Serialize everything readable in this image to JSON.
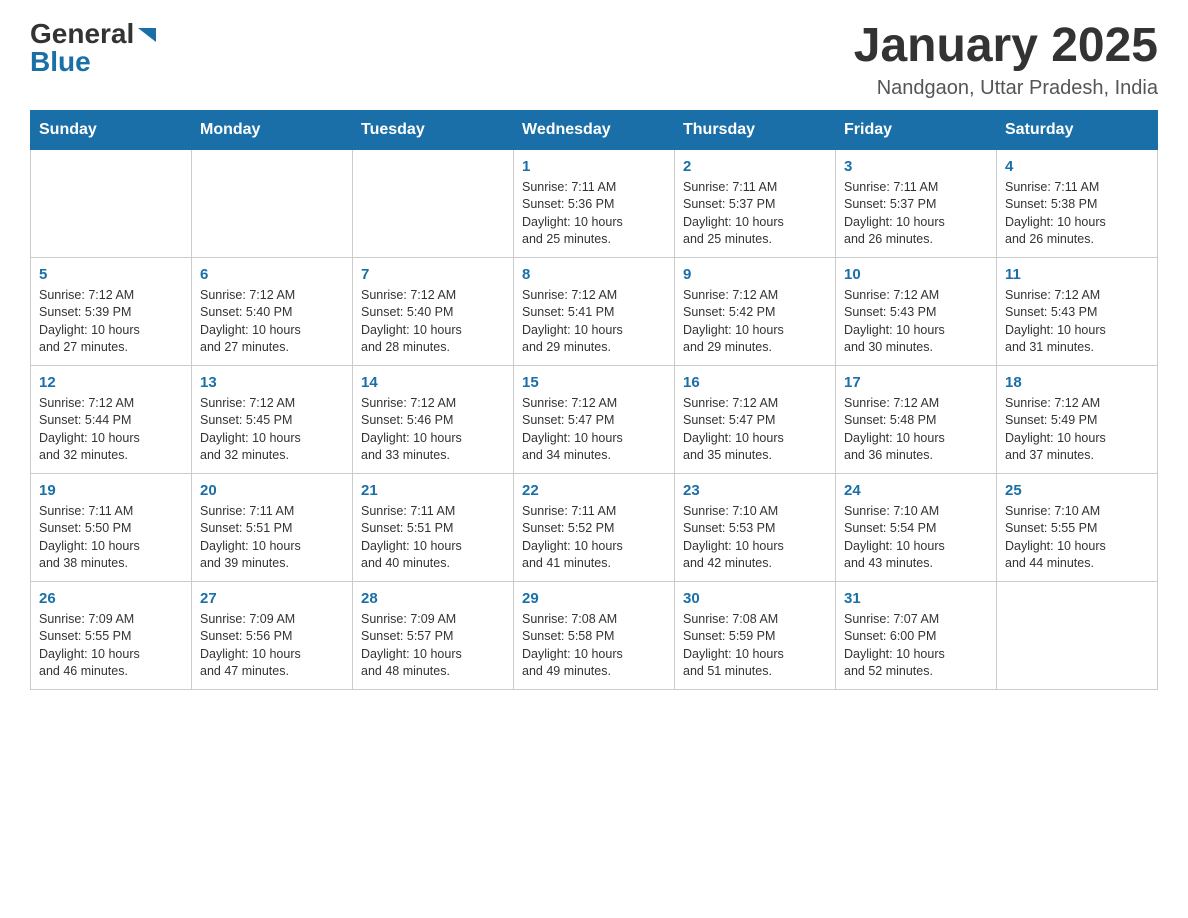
{
  "header": {
    "logo_general": "General",
    "logo_blue": "Blue",
    "month_title": "January 2025",
    "location": "Nandgaon, Uttar Pradesh, India"
  },
  "weekdays": [
    "Sunday",
    "Monday",
    "Tuesday",
    "Wednesday",
    "Thursday",
    "Friday",
    "Saturday"
  ],
  "weeks": [
    [
      {
        "day": "",
        "info": ""
      },
      {
        "day": "",
        "info": ""
      },
      {
        "day": "",
        "info": ""
      },
      {
        "day": "1",
        "info": "Sunrise: 7:11 AM\nSunset: 5:36 PM\nDaylight: 10 hours\nand 25 minutes."
      },
      {
        "day": "2",
        "info": "Sunrise: 7:11 AM\nSunset: 5:37 PM\nDaylight: 10 hours\nand 25 minutes."
      },
      {
        "day": "3",
        "info": "Sunrise: 7:11 AM\nSunset: 5:37 PM\nDaylight: 10 hours\nand 26 minutes."
      },
      {
        "day": "4",
        "info": "Sunrise: 7:11 AM\nSunset: 5:38 PM\nDaylight: 10 hours\nand 26 minutes."
      }
    ],
    [
      {
        "day": "5",
        "info": "Sunrise: 7:12 AM\nSunset: 5:39 PM\nDaylight: 10 hours\nand 27 minutes."
      },
      {
        "day": "6",
        "info": "Sunrise: 7:12 AM\nSunset: 5:40 PM\nDaylight: 10 hours\nand 27 minutes."
      },
      {
        "day": "7",
        "info": "Sunrise: 7:12 AM\nSunset: 5:40 PM\nDaylight: 10 hours\nand 28 minutes."
      },
      {
        "day": "8",
        "info": "Sunrise: 7:12 AM\nSunset: 5:41 PM\nDaylight: 10 hours\nand 29 minutes."
      },
      {
        "day": "9",
        "info": "Sunrise: 7:12 AM\nSunset: 5:42 PM\nDaylight: 10 hours\nand 29 minutes."
      },
      {
        "day": "10",
        "info": "Sunrise: 7:12 AM\nSunset: 5:43 PM\nDaylight: 10 hours\nand 30 minutes."
      },
      {
        "day": "11",
        "info": "Sunrise: 7:12 AM\nSunset: 5:43 PM\nDaylight: 10 hours\nand 31 minutes."
      }
    ],
    [
      {
        "day": "12",
        "info": "Sunrise: 7:12 AM\nSunset: 5:44 PM\nDaylight: 10 hours\nand 32 minutes."
      },
      {
        "day": "13",
        "info": "Sunrise: 7:12 AM\nSunset: 5:45 PM\nDaylight: 10 hours\nand 32 minutes."
      },
      {
        "day": "14",
        "info": "Sunrise: 7:12 AM\nSunset: 5:46 PM\nDaylight: 10 hours\nand 33 minutes."
      },
      {
        "day": "15",
        "info": "Sunrise: 7:12 AM\nSunset: 5:47 PM\nDaylight: 10 hours\nand 34 minutes."
      },
      {
        "day": "16",
        "info": "Sunrise: 7:12 AM\nSunset: 5:47 PM\nDaylight: 10 hours\nand 35 minutes."
      },
      {
        "day": "17",
        "info": "Sunrise: 7:12 AM\nSunset: 5:48 PM\nDaylight: 10 hours\nand 36 minutes."
      },
      {
        "day": "18",
        "info": "Sunrise: 7:12 AM\nSunset: 5:49 PM\nDaylight: 10 hours\nand 37 minutes."
      }
    ],
    [
      {
        "day": "19",
        "info": "Sunrise: 7:11 AM\nSunset: 5:50 PM\nDaylight: 10 hours\nand 38 minutes."
      },
      {
        "day": "20",
        "info": "Sunrise: 7:11 AM\nSunset: 5:51 PM\nDaylight: 10 hours\nand 39 minutes."
      },
      {
        "day": "21",
        "info": "Sunrise: 7:11 AM\nSunset: 5:51 PM\nDaylight: 10 hours\nand 40 minutes."
      },
      {
        "day": "22",
        "info": "Sunrise: 7:11 AM\nSunset: 5:52 PM\nDaylight: 10 hours\nand 41 minutes."
      },
      {
        "day": "23",
        "info": "Sunrise: 7:10 AM\nSunset: 5:53 PM\nDaylight: 10 hours\nand 42 minutes."
      },
      {
        "day": "24",
        "info": "Sunrise: 7:10 AM\nSunset: 5:54 PM\nDaylight: 10 hours\nand 43 minutes."
      },
      {
        "day": "25",
        "info": "Sunrise: 7:10 AM\nSunset: 5:55 PM\nDaylight: 10 hours\nand 44 minutes."
      }
    ],
    [
      {
        "day": "26",
        "info": "Sunrise: 7:09 AM\nSunset: 5:55 PM\nDaylight: 10 hours\nand 46 minutes."
      },
      {
        "day": "27",
        "info": "Sunrise: 7:09 AM\nSunset: 5:56 PM\nDaylight: 10 hours\nand 47 minutes."
      },
      {
        "day": "28",
        "info": "Sunrise: 7:09 AM\nSunset: 5:57 PM\nDaylight: 10 hours\nand 48 minutes."
      },
      {
        "day": "29",
        "info": "Sunrise: 7:08 AM\nSunset: 5:58 PM\nDaylight: 10 hours\nand 49 minutes."
      },
      {
        "day": "30",
        "info": "Sunrise: 7:08 AM\nSunset: 5:59 PM\nDaylight: 10 hours\nand 51 minutes."
      },
      {
        "day": "31",
        "info": "Sunrise: 7:07 AM\nSunset: 6:00 PM\nDaylight: 10 hours\nand 52 minutes."
      },
      {
        "day": "",
        "info": ""
      }
    ]
  ]
}
